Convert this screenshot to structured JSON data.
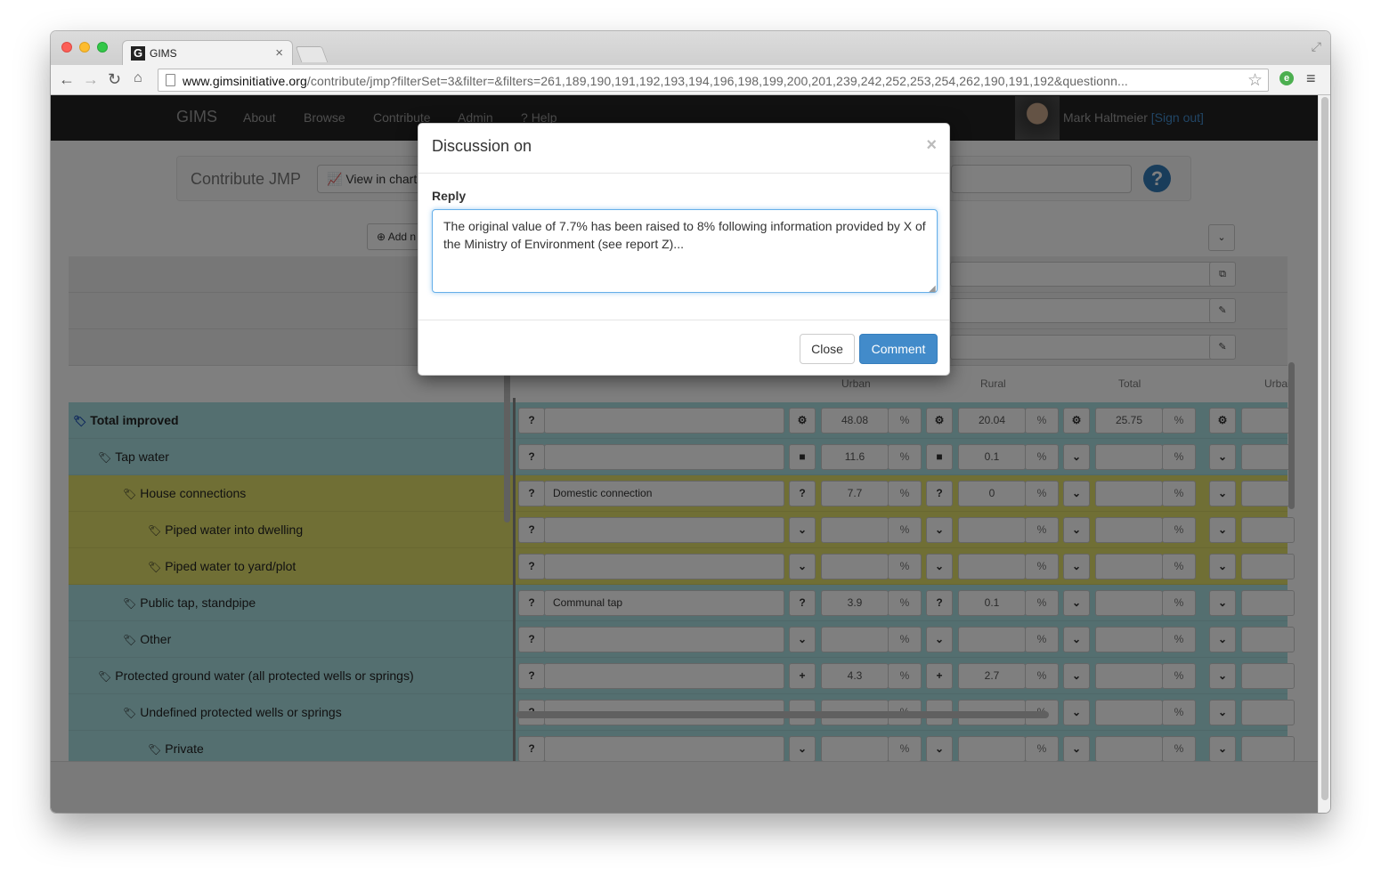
{
  "browser": {
    "tab_title": "GIMS",
    "tab_favicon": "G",
    "url_domain": "www.gimsinitiative.org",
    "url_path": "/contribute/jmp?filterSet=3&filter=&filters=261,189,190,191,192,193,194,196,198,199,200,201,239,242,252,253,254,262,190,191,192&questionn...",
    "icons": [
      "back-icon",
      "forward-icon",
      "reload-icon",
      "home-icon",
      "star-icon",
      "extension-icon",
      "menu-icon",
      "fullscreen-icon"
    ]
  },
  "navbar": {
    "brand": "GIMS",
    "links": [
      "About",
      "Browse",
      "Contribute",
      "Admin",
      "Help"
    ],
    "user_name": "Mark Haltmeier",
    "sign_out": "[Sign out]"
  },
  "subbar": {
    "title": "Contribute JMP",
    "view_chart": "View in chart"
  },
  "grid": {
    "add_button": "Add n",
    "col_headers": [
      "Urban",
      "Rural",
      "Total",
      "Urbai"
    ],
    "rows": [
      {
        "label": "Total improved",
        "comment": "",
        "urban": "48.08",
        "rural": "20.04",
        "total": "25.75",
        "pct": "%"
      },
      {
        "label": "Tap water",
        "comment": "",
        "urban": "11.6",
        "rural": "0.1",
        "total": "",
        "pct": "%"
      },
      {
        "label": "House connections",
        "comment": "Domestic connection",
        "urban": "7.7",
        "rural": "0",
        "total": "",
        "pct": "%"
      },
      {
        "label": "Piped water into dwelling",
        "comment": "",
        "urban": "",
        "rural": "",
        "total": "",
        "pct": "%"
      },
      {
        "label": "Piped water to yard/plot",
        "comment": "",
        "urban": "",
        "rural": "",
        "total": "",
        "pct": "%"
      },
      {
        "label": "Public tap, standpipe",
        "comment": "Communal tap",
        "urban": "3.9",
        "rural": "0.1",
        "total": "",
        "pct": "%"
      },
      {
        "label": "Other",
        "comment": "",
        "urban": "",
        "rural": "",
        "total": "",
        "pct": "%"
      },
      {
        "label": "Protected ground water (all protected wells or springs)",
        "comment": "",
        "urban": "4.3",
        "rural": "2.7",
        "total": "",
        "pct": "%"
      },
      {
        "label": "Undefined protected wells or springs",
        "comment": "",
        "urban": "",
        "rural": "",
        "total": "",
        "pct": "%"
      },
      {
        "label": "Private",
        "comment": "",
        "urban": "",
        "rural": "",
        "total": "",
        "pct": "%"
      }
    ]
  },
  "modal": {
    "title": "Discussion on",
    "close_x": "×",
    "reply_label": "Reply",
    "reply_text": "The original value of 7.7% has been raised to 8% following information provided by X of the Ministry of Environment (see report Z)...",
    "close_button": "Close",
    "comment_button": "Comment"
  }
}
